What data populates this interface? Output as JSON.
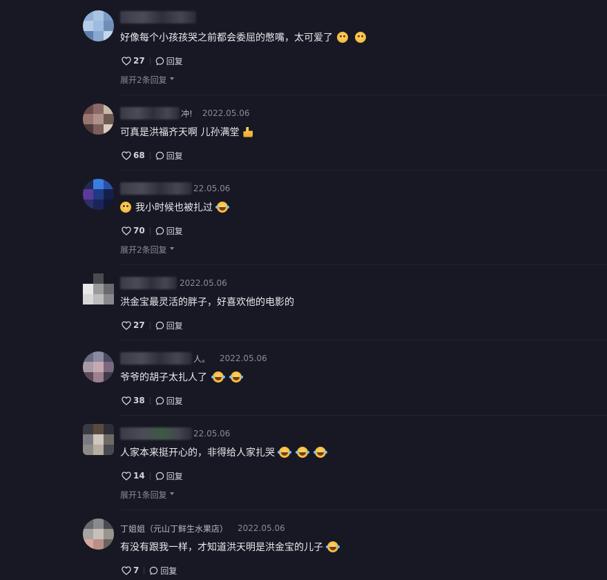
{
  "comments": [
    {
      "name_tail": "",
      "date": "",
      "text": "好像每个小孩孩哭之前都会委屈的憋嘴，太可爱了",
      "likes": "27",
      "reply_label": "回复",
      "expand": "展开2条回复",
      "emojis": [
        "grin-icon",
        "grin-icon"
      ]
    },
    {
      "name_tail": "冲!",
      "date": "2022.05.06",
      "text": "可真是洪福齐天啊 儿孙满堂",
      "likes": "68",
      "reply_label": "回复",
      "expand": "",
      "emojis": [
        "thumbs-up-icon"
      ]
    },
    {
      "name_tail": "",
      "date": "22.05.06",
      "text": "我小时候也被扎过",
      "likes": "70",
      "reply_label": "回复",
      "expand": "展开2条回复",
      "emojis": [
        "laugh-cry-icon"
      ]
    },
    {
      "name_tail": "",
      "date": "2022.05.06",
      "text": "洪金宝最灵活的胖子，好喜欢他的电影的",
      "likes": "27",
      "reply_label": "回复",
      "expand": "",
      "emojis": []
    },
    {
      "name_tail": "人。",
      "date": "2022.05.06",
      "text": "爷爷的胡子太扎人了",
      "likes": "38",
      "reply_label": "回复",
      "expand": "",
      "emojis": [
        "laugh-cry-icon",
        "laugh-cry-icon"
      ]
    },
    {
      "name_tail": "",
      "date": "22.05.06",
      "text": "人家本来挺开心的，非得给人家扎哭",
      "likes": "14",
      "reply_label": "回复",
      "expand": "展开1条回复",
      "emojis": [
        "laugh-cry-icon",
        "laugh-cry-icon",
        "laugh-cry-icon"
      ]
    },
    {
      "name_tail": "丁姐姐（元山丁鲜生水果店）",
      "date": "2022.05.06",
      "text": "有没有跟我一样，才知道洪天明是洪金宝的儿子",
      "likes": "7",
      "reply_label": "回复",
      "expand": "",
      "emojis": [
        "laugh-cry-icon"
      ]
    }
  ]
}
